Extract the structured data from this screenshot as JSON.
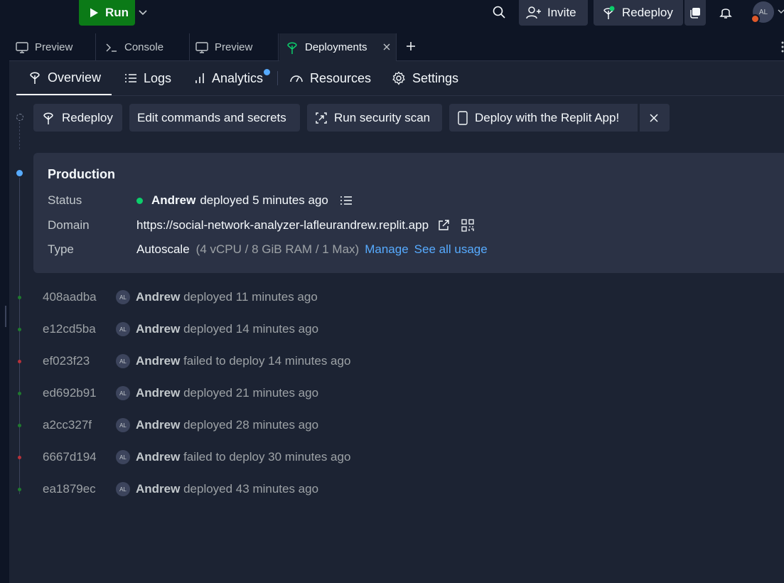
{
  "topbar": {
    "run_label": "Run",
    "invite_label": "Invite",
    "redeploy_label": "Redeploy",
    "avatar_initials": "AL"
  },
  "tabs": [
    {
      "label": "Preview",
      "icon": "monitor-icon"
    },
    {
      "label": "Console",
      "icon": "terminal-icon"
    },
    {
      "label": "Preview",
      "icon": "monitor-icon"
    },
    {
      "label": "Deployments",
      "icon": "deploy-icon",
      "active": true
    }
  ],
  "subnav": {
    "overview": "Overview",
    "logs": "Logs",
    "analytics": "Analytics",
    "resources": "Resources",
    "settings": "Settings"
  },
  "actions": {
    "redeploy": "Redeploy",
    "edit_commands": "Edit commands and secrets",
    "security_scan": "Run security scan",
    "replit_app": "Deploy with the Replit App!"
  },
  "production": {
    "title": "Production",
    "status_label": "Status",
    "status_user": "Andrew",
    "status_text": "deployed 5 minutes ago",
    "domain_label": "Domain",
    "domain_value": "https://social-network-analyzer-lafleurandrew.replit.app",
    "type_label": "Type",
    "type_value": "Autoscale",
    "type_detail": "(4 vCPU / 8 GiB RAM / 1 Max)",
    "manage_link": "Manage",
    "usage_link": "See all usage"
  },
  "deployments": [
    {
      "hash": "408aadba",
      "initials": "AL",
      "user": "Andrew",
      "text": "deployed 11 minutes ago",
      "status": "success"
    },
    {
      "hash": "e12cd5ba",
      "initials": "AL",
      "user": "Andrew",
      "text": "deployed 14 minutes ago",
      "status": "success"
    },
    {
      "hash": "ef023f23",
      "initials": "AL",
      "user": "Andrew",
      "text": "failed to deploy 14 minutes ago",
      "status": "failed"
    },
    {
      "hash": "ed692b91",
      "initials": "AL",
      "user": "Andrew",
      "text": "deployed 21 minutes ago",
      "status": "success"
    },
    {
      "hash": "a2cc327f",
      "initials": "AL",
      "user": "Andrew",
      "text": "deployed 28 minutes ago",
      "status": "success"
    },
    {
      "hash": "6667d194",
      "initials": "AL",
      "user": "Andrew",
      "text": "failed to deploy 30 minutes ago",
      "status": "failed"
    },
    {
      "hash": "ea1879ec",
      "initials": "AL",
      "user": "Andrew",
      "text": "deployed 43 minutes ago",
      "status": "success"
    }
  ],
  "colors": {
    "success": "#1f7a2e",
    "failed": "#b8323a",
    "accent": "#57abff",
    "run_green": "#0b7a17"
  }
}
